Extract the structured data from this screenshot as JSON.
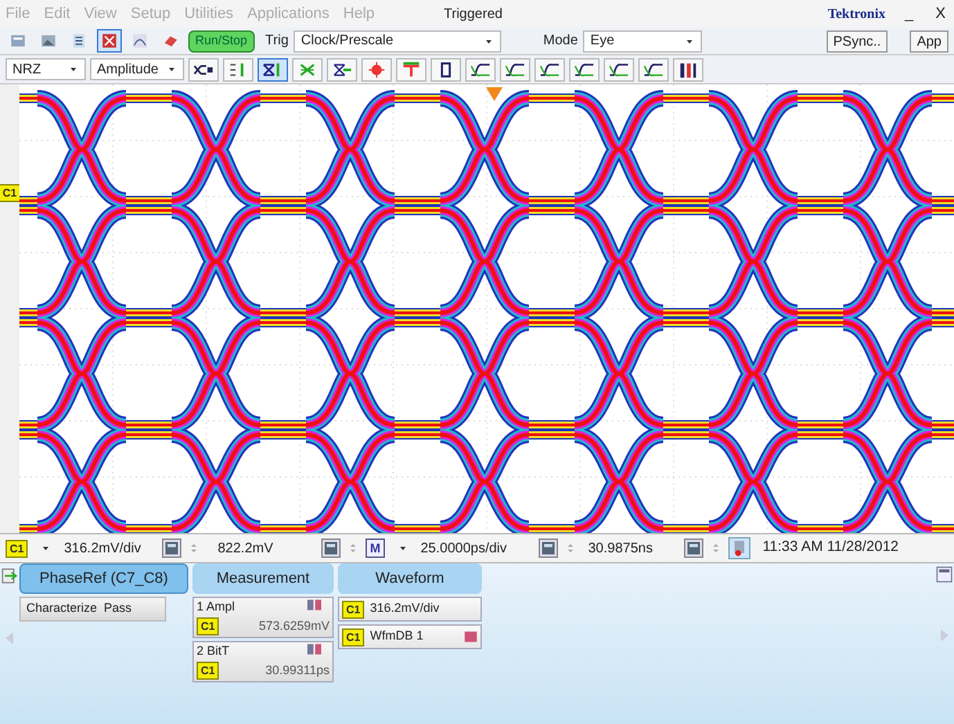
{
  "menu": [
    "File",
    "Edit",
    "View",
    "Setup",
    "Utilities",
    "Applications",
    "Help"
  ],
  "acquisition_status": "Triggered",
  "brand": "Tektronix",
  "window_controls": [
    "_",
    "X"
  ],
  "toolbar_1": {
    "icon_buttons": [
      {
        "selected": false
      },
      {
        "selected": false
      },
      {
        "selected": false
      },
      {
        "selected": true
      },
      {
        "selected": false
      },
      {
        "selected": false
      }
    ],
    "run_stop": {
      "label": "Run/Stop",
      "running": true
    },
    "trigger": {
      "label": "Trig",
      "value": "Clock/Prescale"
    },
    "mode": {
      "label": "Mode",
      "value": "Eye"
    },
    "buttons": [
      "PSync..",
      "App"
    ]
  },
  "toolbar_2": {
    "dropdowns": [
      "NRZ",
      "Amplitude"
    ],
    "icon_buttons": [
      {
        "selected": false
      },
      {
        "selected": false
      },
      {
        "selected": true
      },
      {
        "selected": false
      },
      {
        "selected": false
      },
      {
        "selected": false
      },
      {
        "selected": false
      },
      {
        "selected": false
      },
      {
        "selected": false
      },
      {
        "selected": false
      },
      {
        "selected": false
      },
      {
        "selected": false
      },
      {
        "selected": false
      },
      {
        "selected": false
      },
      {
        "selected": false
      }
    ]
  },
  "plot": {
    "channel_marker": "C1"
  },
  "status_bar": {
    "channel": "C1",
    "vertical_scale": "316.2mV/div",
    "vertical_offset": "822.2mV",
    "timebase": "M",
    "horizontal_scale": "25.0000ps/div",
    "horizontal_position": "30.9875ns",
    "datetime": "11:33 AM 11/28/2012"
  },
  "panel": {
    "phase_ref": {
      "title": "PhaseRef (C7_C8)",
      "selected": true,
      "button": "Characterize  Pass"
    },
    "measurement": {
      "title": "Measurement",
      "items": [
        {
          "label": "1 Ampl",
          "source": "C1",
          "value": "573.6259mV"
        },
        {
          "label": "2 BitT",
          "source": "C1",
          "value": "30.99311ps"
        }
      ]
    },
    "waveform": {
      "title": "Waveform",
      "items": [
        {
          "source": "C1",
          "label": "316.2mV/div"
        },
        {
          "source": "C1",
          "label": "WfmDB 1"
        }
      ]
    }
  }
}
